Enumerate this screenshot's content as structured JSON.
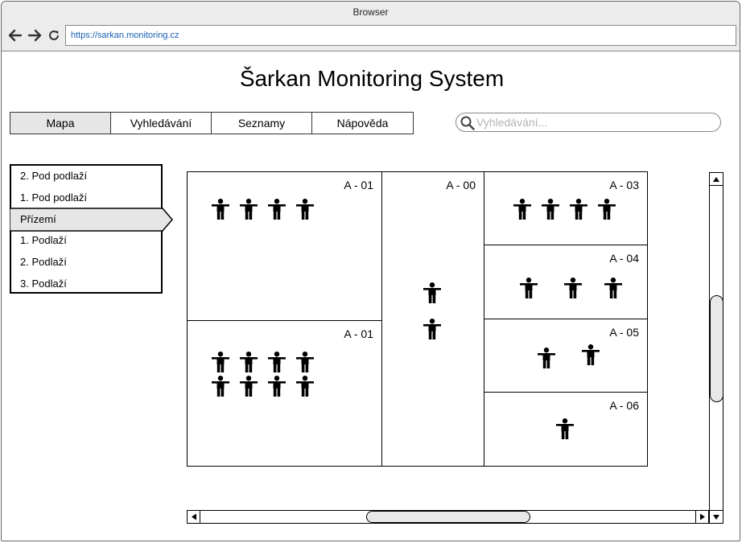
{
  "browser": {
    "title": "Browser",
    "url": "https://sarkan.monitoring.cz"
  },
  "page": {
    "title": "Šarkan Monitoring System"
  },
  "tabs": [
    {
      "label": "Mapa",
      "active": true
    },
    {
      "label": "Vyhledávání",
      "active": false
    },
    {
      "label": "Seznamy",
      "active": false
    },
    {
      "label": "Nápověda",
      "active": false
    }
  ],
  "search": {
    "placeholder": "Vyhledávání..."
  },
  "floors": [
    {
      "label": "2. Pod podlaží",
      "active": false
    },
    {
      "label": "1. Pod podlaží",
      "active": false
    },
    {
      "label": "Přízemí",
      "active": true
    },
    {
      "label": "1. Podlaží",
      "active": false
    },
    {
      "label": "2. Podlaží",
      "active": false
    },
    {
      "label": "3. Podlaží",
      "active": false
    }
  ],
  "rooms": [
    {
      "label": "A - 01",
      "people": 4
    },
    {
      "label": "A - 01",
      "people": 8
    },
    {
      "label": "A - 00",
      "people": 2
    },
    {
      "label": "A - 03",
      "people": 4
    },
    {
      "label": "A - 04",
      "people": 3
    },
    {
      "label": "A - 05",
      "people": 2
    },
    {
      "label": "A - 06",
      "people": 1
    }
  ],
  "icons": {
    "back": "arrow-left-icon",
    "forward": "arrow-right-icon",
    "reload": "reload-icon",
    "search": "search-icon",
    "person": "person-icon"
  },
  "colors": {
    "active_tab": "#e6e6e6",
    "url_text": "#1a5fb4"
  }
}
